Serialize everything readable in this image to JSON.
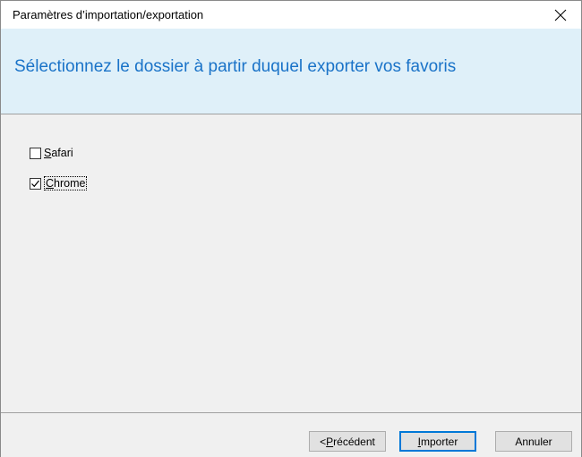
{
  "window": {
    "title": "Paramètres d’importation/exportation",
    "close_glyph": "✕"
  },
  "header": {
    "title": "Sélectionnez le dossier à partir duquel exporter vos favoris"
  },
  "options": [
    {
      "label_first": "S",
      "label_rest": "afari",
      "checked": false
    },
    {
      "label_first": "C",
      "label_rest": "hrome",
      "checked": true
    }
  ],
  "buttons": {
    "previous": {
      "prefix": "< ",
      "mnemonic": "P",
      "rest": "récédent"
    },
    "import": {
      "mnemonic": "I",
      "rest": "mporter"
    },
    "cancel": {
      "label": "Annuler"
    }
  },
  "colors": {
    "header_bg": "#dff0f9",
    "header_text": "#1a73c8",
    "content_bg": "#f0f0f0",
    "default_button_border": "#0078d7"
  }
}
